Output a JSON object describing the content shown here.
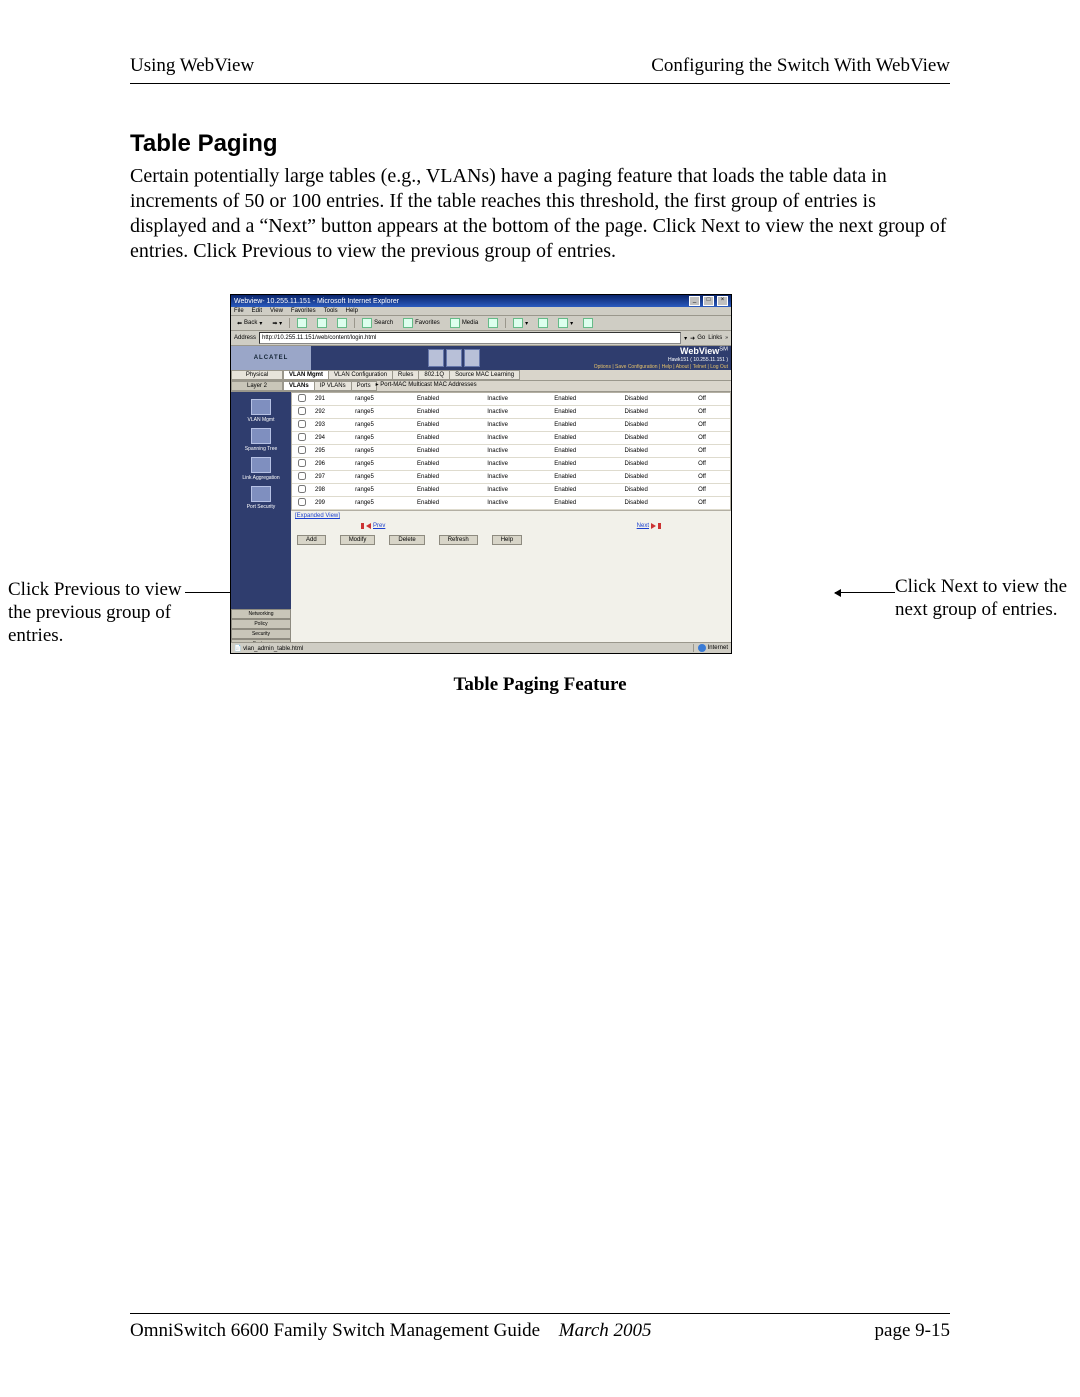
{
  "header": {
    "left": "Using WebView",
    "right": "Configuring the Switch With WebView"
  },
  "section_title": "Table Paging",
  "body_para": "Certain potentially large tables (e.g., VLANs) have a paging feature that loads the table data in increments of 50 or 100 entries. If the table reaches this threshold, the first group of entries is displayed and a “Next” button appears at the bottom of the page. Click Next to view the next group of entries. Click Previous to view the previous group of entries.",
  "callout_left": "Click Previous to view the previous group of entries.",
  "callout_right": "Click Next to view the next group of entries.",
  "fig_caption": "Table Paging Feature",
  "ie": {
    "title": "Webview- 10.255.11.151 - Microsoft Internet Explorer",
    "menus": [
      "File",
      "Edit",
      "View",
      "Favorites",
      "Tools",
      "Help"
    ],
    "toolbar": {
      "back": "Back",
      "search": "Search",
      "favorites": "Favorites",
      "media": "Media"
    },
    "address_label": "Address",
    "address_value": "http://10.255.11.151/web/content/login.html",
    "go": "Go",
    "links": "Links",
    "status_left": "vlan_admin_table.html",
    "status_right": "Internet"
  },
  "wv": {
    "logo": "ALCATEL",
    "brand": "WebView",
    "hawk": "Hawk151  ( 10.255.11.151 )",
    "options": "Options | Save Configuration | Help | About | Telnet | Log Out",
    "side_top": [
      "Physical",
      "Layer 2"
    ],
    "top_tabs": [
      "VLAN Mgmt",
      "VLAN Configuration",
      "Rules",
      "802.1Q",
      "Source MAC Learning"
    ],
    "sub_tabs": [
      "VLANs",
      "IP VLANs",
      "Ports"
    ],
    "crumb": "Port-MAC Multicast MAC Addresses",
    "side_items": [
      "VLAN Mgmt",
      "Spanning Tree",
      "Link Aggregation",
      "Port Security"
    ],
    "side_bottom": [
      "Networking",
      "Policy",
      "Security",
      "System"
    ],
    "table": {
      "rows": [
        {
          "id": "291",
          "c2": "range5",
          "c3": "Enabled",
          "c4": "Inactive",
          "c5": "Enabled",
          "c6": "Disabled",
          "c7": "Off"
        },
        {
          "id": "292",
          "c2": "range5",
          "c3": "Enabled",
          "c4": "Inactive",
          "c5": "Enabled",
          "c6": "Disabled",
          "c7": "Off"
        },
        {
          "id": "293",
          "c2": "range5",
          "c3": "Enabled",
          "c4": "Inactive",
          "c5": "Enabled",
          "c6": "Disabled",
          "c7": "Off"
        },
        {
          "id": "294",
          "c2": "range5",
          "c3": "Enabled",
          "c4": "Inactive",
          "c5": "Enabled",
          "c6": "Disabled",
          "c7": "Off"
        },
        {
          "id": "295",
          "c2": "range5",
          "c3": "Enabled",
          "c4": "Inactive",
          "c5": "Enabled",
          "c6": "Disabled",
          "c7": "Off"
        },
        {
          "id": "296",
          "c2": "range5",
          "c3": "Enabled",
          "c4": "Inactive",
          "c5": "Enabled",
          "c6": "Disabled",
          "c7": "Off"
        },
        {
          "id": "297",
          "c2": "range5",
          "c3": "Enabled",
          "c4": "Inactive",
          "c5": "Enabled",
          "c6": "Disabled",
          "c7": "Off"
        },
        {
          "id": "298",
          "c2": "range5",
          "c3": "Enabled",
          "c4": "Inactive",
          "c5": "Enabled",
          "c6": "Disabled",
          "c7": "Off"
        },
        {
          "id": "299",
          "c2": "range5",
          "c3": "Enabled",
          "c4": "Inactive",
          "c5": "Enabled",
          "c6": "Disabled",
          "c7": "Off"
        }
      ]
    },
    "expanded_view": "[Expanded View]",
    "prev": "Prev",
    "next": "Next",
    "actions": [
      "Add",
      "Modify",
      "Delete",
      "Refresh",
      "Help"
    ]
  },
  "footer": {
    "left": "OmniSwitch 6600 Family Switch Management Guide",
    "date": "March 2005",
    "right": "page 9-15"
  }
}
